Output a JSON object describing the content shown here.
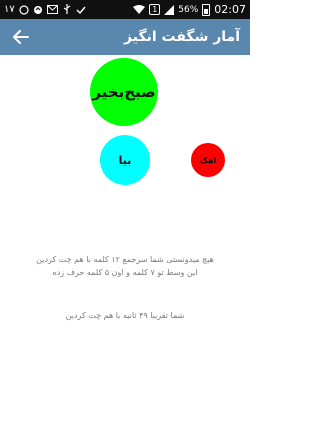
{
  "status_bar": {
    "notification_count": "١٧",
    "sim_label": "1",
    "battery_percent": "56%",
    "time": "02:07"
  },
  "app_bar": {
    "title": "آمار شگفت انگیز"
  },
  "bubbles": {
    "green": "صبح‌بخیر",
    "cyan": "بیا",
    "red": "اهک"
  },
  "summary": {
    "line1": "هیچ میدونستی شما سرجمع ۱۲ کلمه با هم چت کردین",
    "line2": "این وسط تو ۷ کلمه و اون ۵ کلمه حرف زده",
    "line3": "شما تقریبا ۴۹ ثانیه با هم چت کردین"
  },
  "colors": {
    "app_bar": "#5a87ad",
    "green_bubble": "#00ff00",
    "cyan_bubble": "#00ffff",
    "red_bubble": "#ff0000"
  }
}
